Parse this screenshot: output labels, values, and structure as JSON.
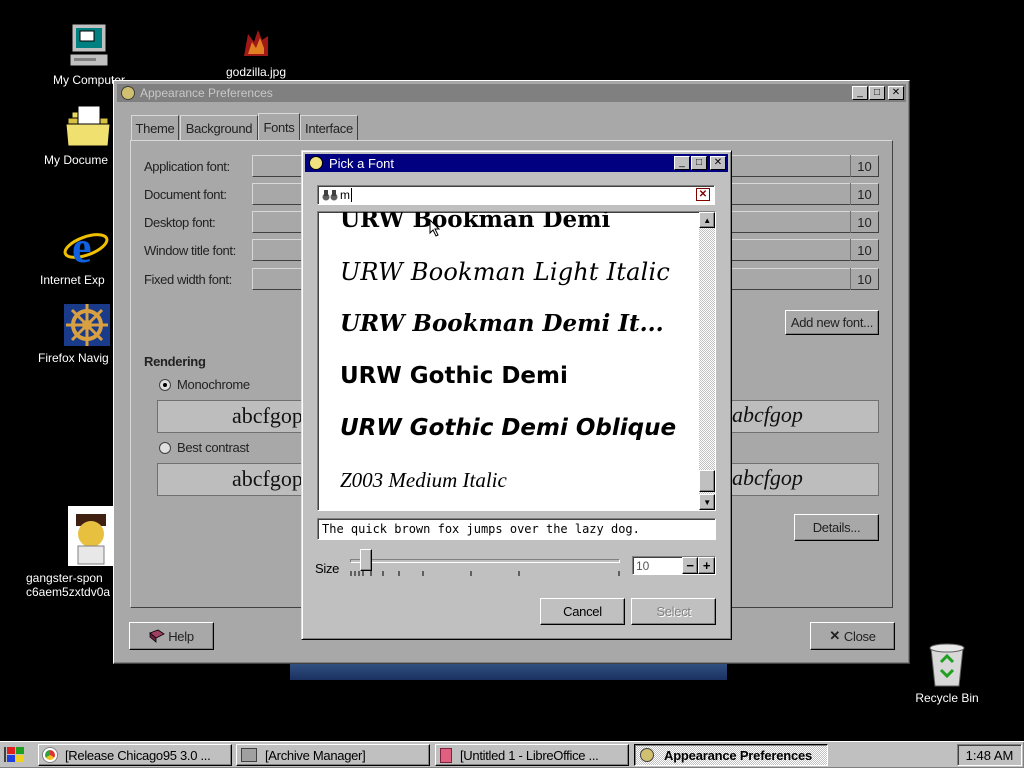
{
  "desktop": {
    "icons": [
      {
        "label": "My Computer",
        "icon": "computer-icon"
      },
      {
        "label": "godzilla.jpg",
        "icon": "image-file-icon"
      },
      {
        "label": "My Docume",
        "icon": "folder-icon"
      },
      {
        "label": "Internet Exp",
        "icon": "internet-explorer-icon"
      },
      {
        "label": "Firefox Navig",
        "icon": "firefox-navigator-icon"
      },
      {
        "label": "gangster-spon",
        "label2": "c6aem5zxtdv0a",
        "icon": "image-file-icon"
      },
      {
        "label": "Recycle Bin",
        "icon": "recycle-bin-icon"
      }
    ]
  },
  "appearance": {
    "title": "Appearance Preferences",
    "tabs": [
      "Theme",
      "Background",
      "Fonts",
      "Interface"
    ],
    "active_tab": "Fonts",
    "font_rows": [
      {
        "label": "Application font:",
        "size": "10"
      },
      {
        "label": "Document font:",
        "size": "10"
      },
      {
        "label": "Desktop font:",
        "size": "10"
      },
      {
        "label": "Window title font:",
        "size": "10"
      },
      {
        "label": "Fixed width font:",
        "size": "10"
      }
    ],
    "add_font_label": "Add new font...",
    "rendering_heading": "Rendering",
    "rendering_options": [
      {
        "label": "Monochrome",
        "selected": true,
        "preview_left": "abcfgop",
        "preview_right": "abcfgop"
      },
      {
        "label": "Best contrast",
        "selected": false,
        "preview_left": "abcfgop",
        "preview_right": "abcfgop"
      }
    ],
    "details_label": "Details...",
    "help_label": "Help",
    "close_label": "Close"
  },
  "font_dialog": {
    "title": "Pick a Font",
    "search_value": "m",
    "fonts": [
      "URW Bookman Demi",
      "URW Bookman Light Italic",
      "URW Bookman Demi It...",
      "URW Gothic Demi",
      "URW Gothic Demi Oblique",
      "Z003 Medium Italic"
    ],
    "preview_text": "The quick brown fox jumps over the lazy dog.",
    "size_label": "Size",
    "size_value": "10",
    "cancel_label": "Cancel",
    "select_label": "Select"
  },
  "taskbar": {
    "tasks": [
      {
        "label": "[Release Chicago95 3.0 ...",
        "icon": "chrome-icon",
        "active": false
      },
      {
        "label": "[Archive Manager]",
        "icon": "archive-manager-icon",
        "active": false
      },
      {
        "label": "[Untitled 1 - LibreOffice ...",
        "icon": "libreoffice-icon",
        "active": false
      },
      {
        "label": "Appearance Preferences",
        "icon": "appearance-icon",
        "active": true
      }
    ],
    "clock": "1:48 AM"
  },
  "colors": {
    "desktop": "#000000",
    "titlebar_active": "#000080",
    "window_face": "#c0c0c0"
  }
}
